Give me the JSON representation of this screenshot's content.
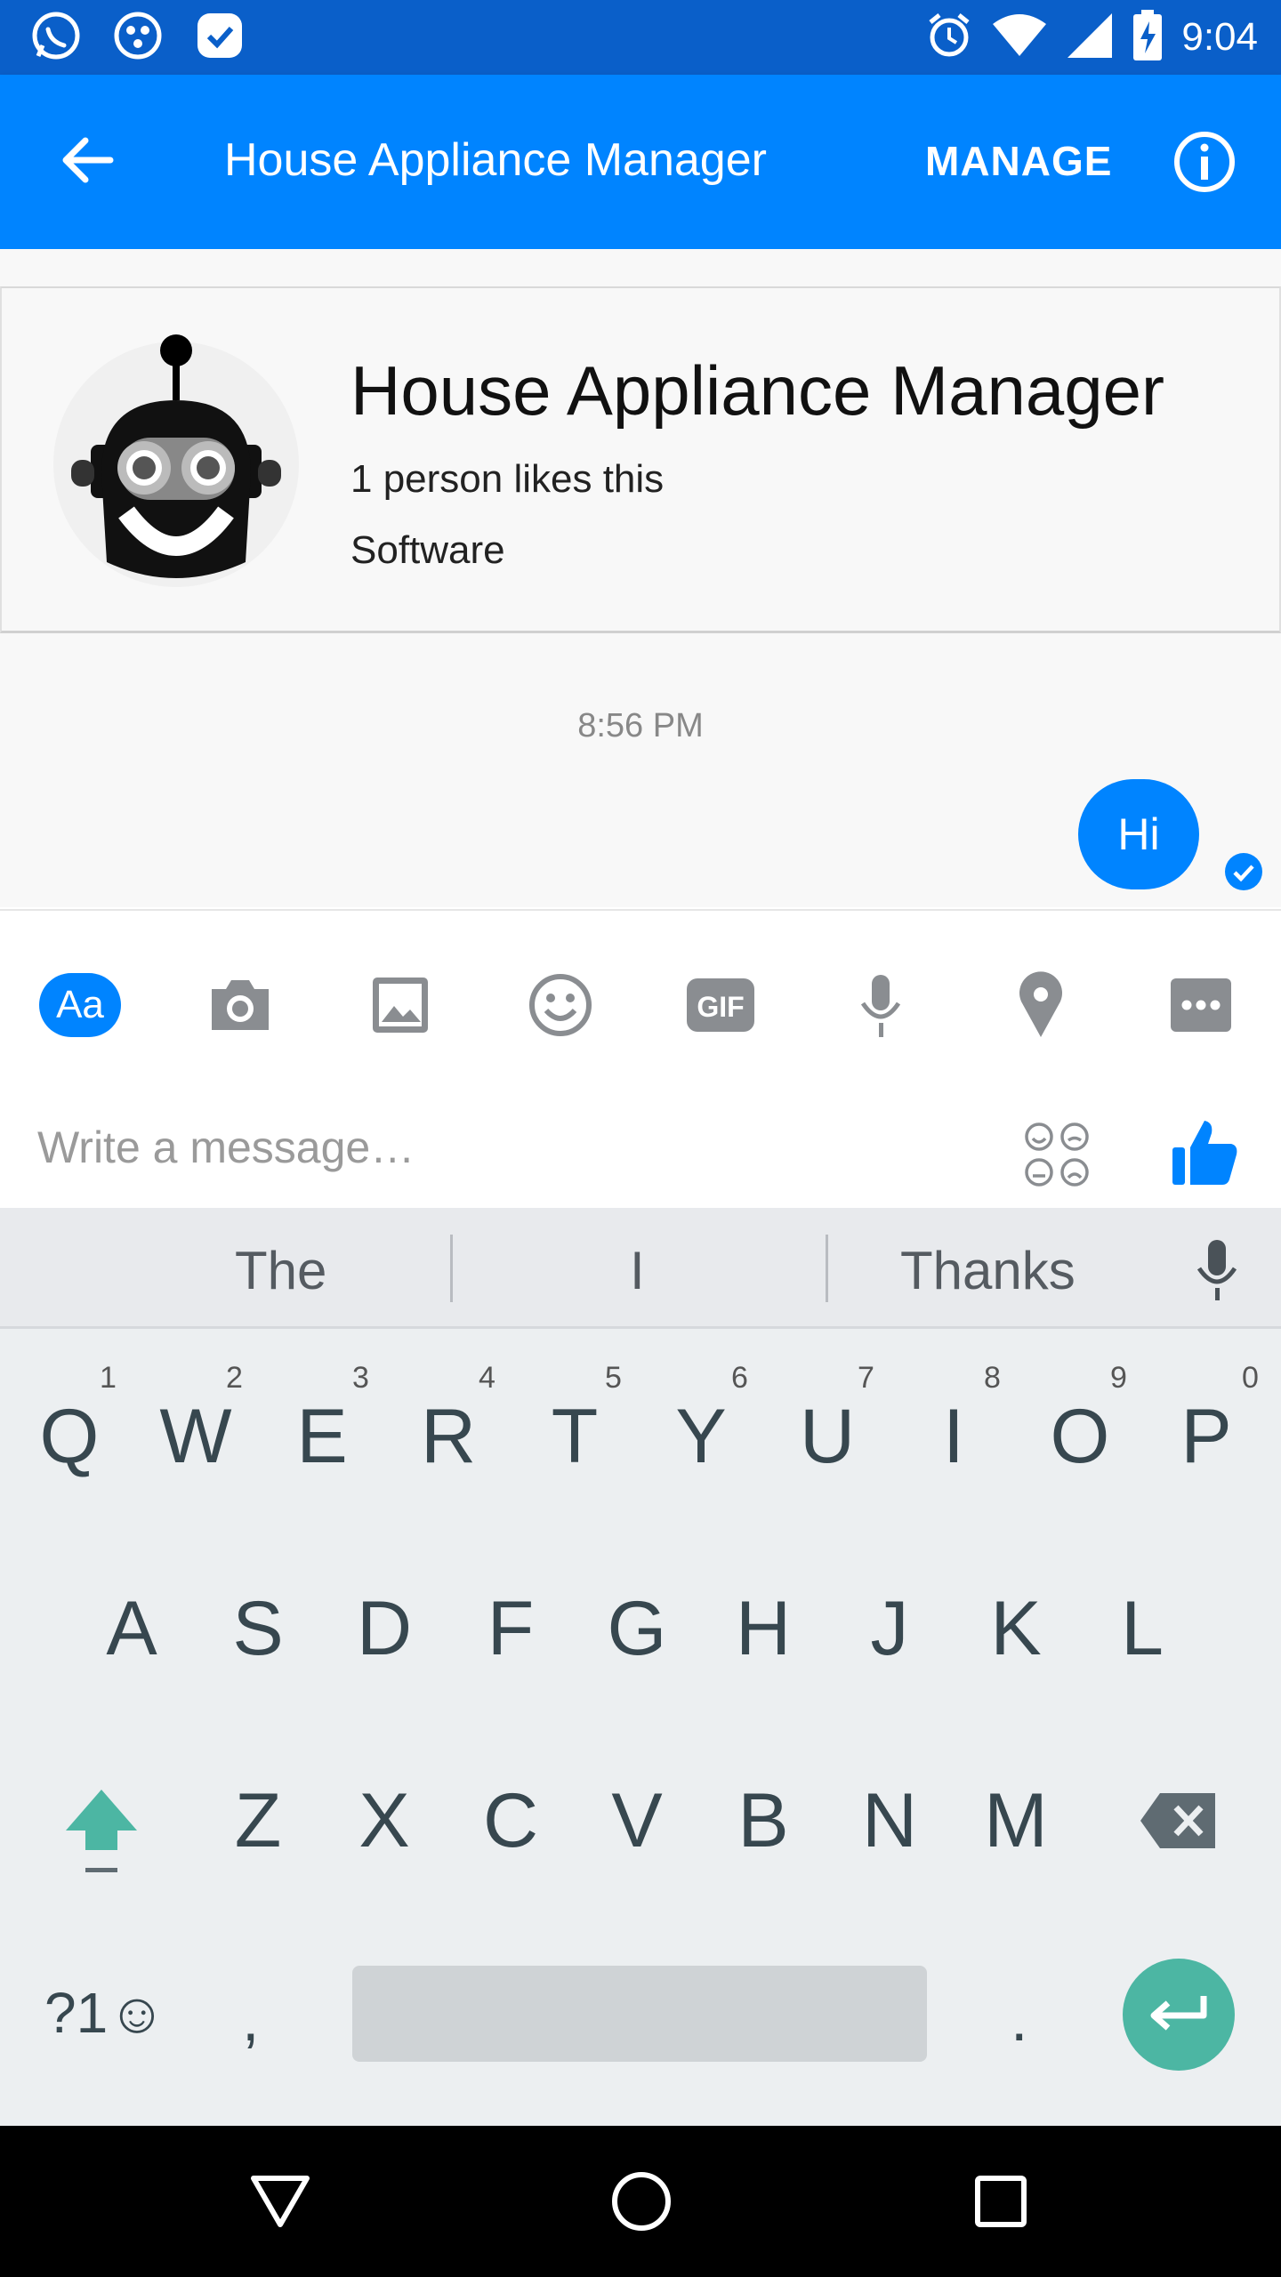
{
  "status_bar": {
    "icons": [
      "whatsapp-icon",
      "network-app-icon",
      "tasks-app-icon",
      "alarm-icon",
      "wifi-icon",
      "signal-icon",
      "battery-charging-icon"
    ],
    "time": "9:04"
  },
  "app_bar": {
    "title": "House Appliance Manager",
    "manage_label": "MANAGE",
    "icons": {
      "back": "arrow-left-icon",
      "info": "info-icon"
    },
    "color": "#0084ff"
  },
  "page_card": {
    "name": "House Appliance Manager",
    "likes": "1 person likes this",
    "category": "Software",
    "avatar": "robot-avatar"
  },
  "conversation": {
    "timestamp": "8:56 PM",
    "messages": [
      {
        "text": "Hi",
        "from": "me",
        "status": "sent"
      }
    ]
  },
  "composer": {
    "tools": [
      "aa-text-icon",
      "camera-icon",
      "image-icon",
      "emoji-icon",
      "gif-icon",
      "microphone-icon",
      "location-pin-icon",
      "more-icon"
    ],
    "aa_label": "Aa",
    "gif_label": "GIF",
    "placeholder": "Write a message…",
    "icons": {
      "stickers": "stickers-icon",
      "like": "thumbs-up-icon"
    }
  },
  "keyboard": {
    "suggestions": [
      "The",
      "I",
      "Thanks"
    ],
    "row1": [
      {
        "key": "Q",
        "hint": "1"
      },
      {
        "key": "W",
        "hint": "2"
      },
      {
        "key": "E",
        "hint": "3"
      },
      {
        "key": "R",
        "hint": "4"
      },
      {
        "key": "T",
        "hint": "5"
      },
      {
        "key": "Y",
        "hint": "6"
      },
      {
        "key": "U",
        "hint": "7"
      },
      {
        "key": "I",
        "hint": "8"
      },
      {
        "key": "O",
        "hint": "9"
      },
      {
        "key": "P",
        "hint": "0"
      }
    ],
    "row2": [
      "A",
      "S",
      "D",
      "F",
      "G",
      "H",
      "J",
      "K",
      "L"
    ],
    "row3": [
      "Z",
      "X",
      "C",
      "V",
      "B",
      "N",
      "M"
    ],
    "symbols_label": "?1☺",
    "comma": ",",
    "period": ".",
    "accent": "#4cb6a3"
  },
  "nav_bar": {
    "icons": [
      "back-triangle-icon",
      "home-circle-icon",
      "recents-square-icon"
    ]
  }
}
